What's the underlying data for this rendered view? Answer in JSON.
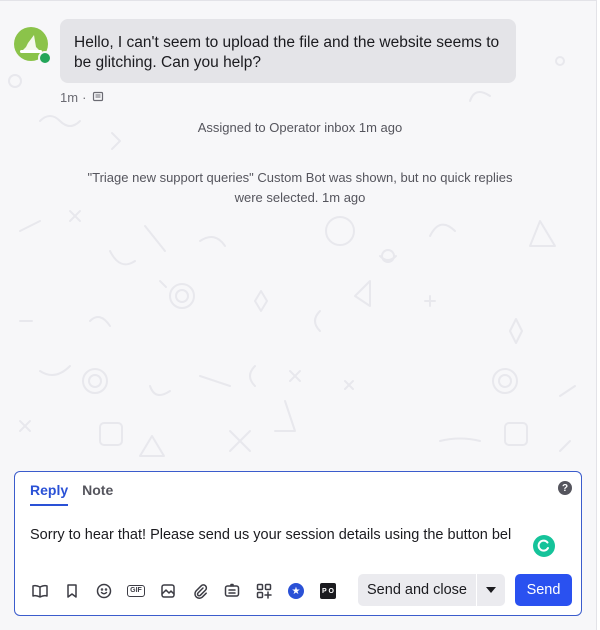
{
  "message": {
    "text": "Hello, I can't seem to upload the file and the website seems to be glitching. Can you help?",
    "time": "1m",
    "separator": "·"
  },
  "events": [
    "Assigned to Operator inbox 1m ago",
    "\"Triage new support queries\" Custom Bot was shown, but no quick replies were selected. 1m ago"
  ],
  "composer": {
    "tabs": [
      {
        "label": "Reply",
        "active": true
      },
      {
        "label": "Note",
        "active": false
      }
    ],
    "help_icon": "?",
    "draft": "Sorry to hear that! Please send us your session details using the button bel",
    "toolbar_icons": [
      "book-icon",
      "bookmark-icon",
      "emoji-icon",
      "gif-icon",
      "image-icon",
      "attachment-icon",
      "article-icon",
      "apps-icon",
      "star-app-icon",
      "po-app-icon"
    ],
    "gif_label": "GIF",
    "po_label": "P O",
    "send_and_close_label": "Send and close",
    "send_label": "Send"
  },
  "colors": {
    "accent": "#2a51f0",
    "avatar": "#8bc34a",
    "online": "#23a559"
  }
}
